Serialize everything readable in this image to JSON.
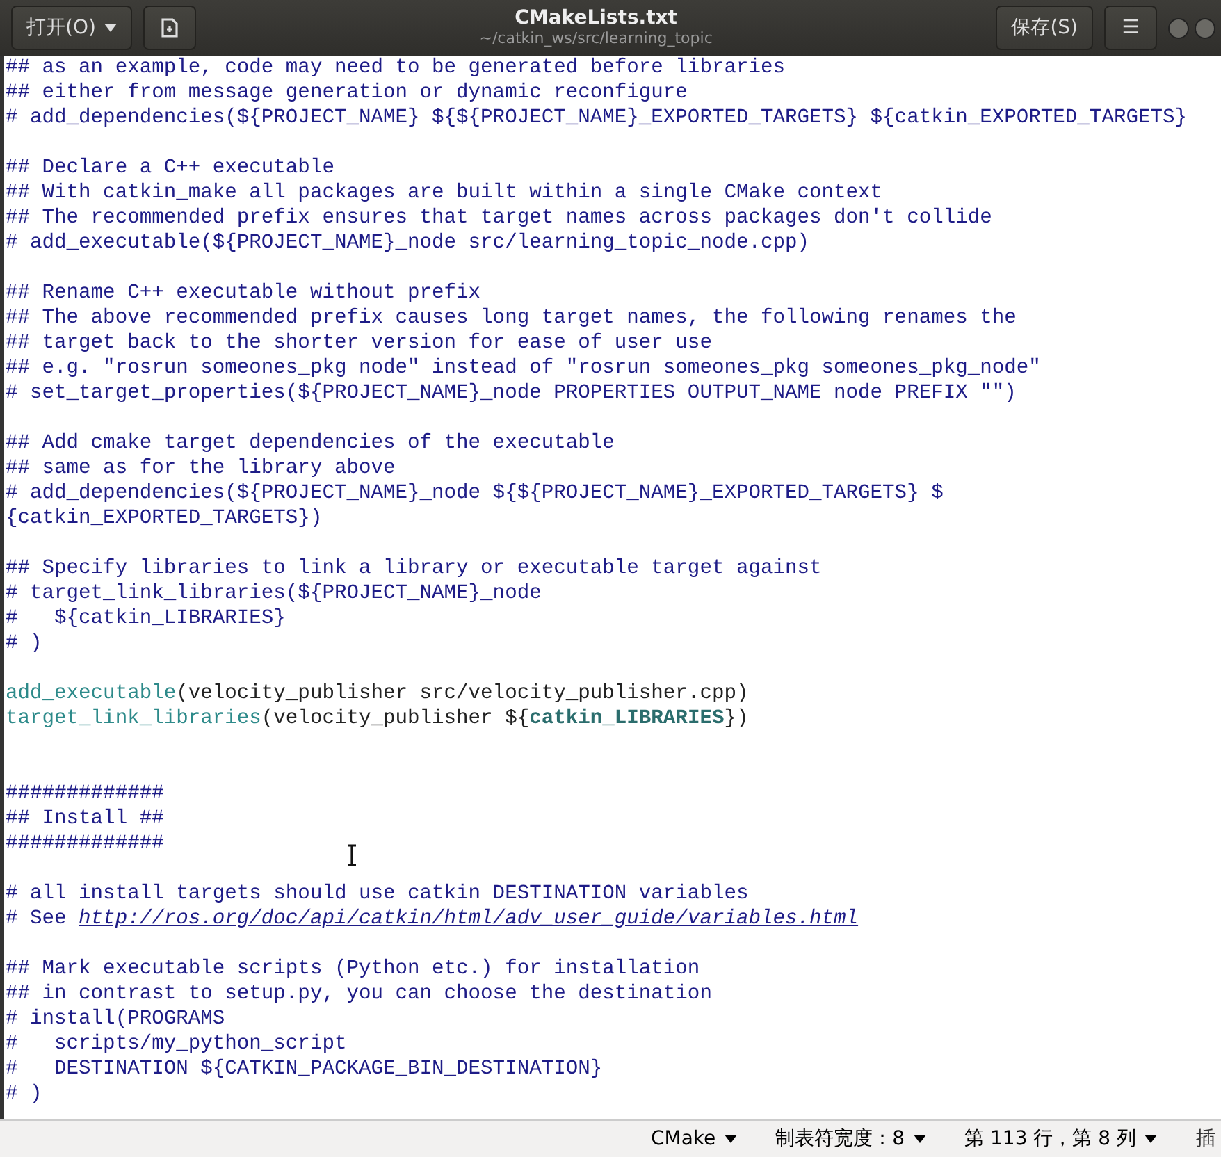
{
  "header": {
    "open_button": "打开(O)",
    "title": "CMakeLists.txt",
    "subtitle": "~/catkin_ws/src/learning_topic",
    "save_button": "保存(S)",
    "menu_button": "☰"
  },
  "lines": [
    {
      "kind": "text",
      "parts": [
        {
          "kind": "comment",
          "text": "## as an example, code may need to be generated before libraries"
        }
      ]
    },
    {
      "kind": "text",
      "parts": [
        {
          "kind": "comment",
          "text": "## either from message generation or dynamic reconfigure"
        }
      ]
    },
    {
      "kind": "text",
      "parts": [
        {
          "kind": "comment",
          "text": "# add_dependencies(${PROJECT_NAME} ${${PROJECT_NAME}_EXPORTED_TARGETS} ${catkin_EXPORTED_TARGETS}"
        }
      ]
    },
    {
      "kind": "blank"
    },
    {
      "kind": "text",
      "parts": [
        {
          "kind": "comment",
          "text": "## Declare a C++ executable"
        }
      ]
    },
    {
      "kind": "text",
      "parts": [
        {
          "kind": "comment",
          "text": "## With catkin_make all packages are built within a single CMake context"
        }
      ]
    },
    {
      "kind": "text",
      "parts": [
        {
          "kind": "comment",
          "text": "## The recommended prefix ensures that target names across packages don't collide"
        }
      ]
    },
    {
      "kind": "text",
      "parts": [
        {
          "kind": "comment",
          "text": "# add_executable(${PROJECT_NAME}_node src/learning_topic_node.cpp)"
        }
      ]
    },
    {
      "kind": "blank"
    },
    {
      "kind": "text",
      "parts": [
        {
          "kind": "comment",
          "text": "## Rename C++ executable without prefix"
        }
      ]
    },
    {
      "kind": "text",
      "parts": [
        {
          "kind": "comment",
          "text": "## The above recommended prefix causes long target names, the following renames the"
        }
      ]
    },
    {
      "kind": "text",
      "parts": [
        {
          "kind": "comment",
          "text": "## target back to the shorter version for ease of user use"
        }
      ]
    },
    {
      "kind": "text",
      "parts": [
        {
          "kind": "comment",
          "text": "## e.g. \"rosrun someones_pkg node\" instead of \"rosrun someones_pkg someones_pkg_node\""
        }
      ]
    },
    {
      "kind": "text",
      "parts": [
        {
          "kind": "comment",
          "text": "# set_target_properties(${PROJECT_NAME}_node PROPERTIES OUTPUT_NAME node PREFIX \"\")"
        }
      ]
    },
    {
      "kind": "blank"
    },
    {
      "kind": "text",
      "parts": [
        {
          "kind": "comment",
          "text": "## Add cmake target dependencies of the executable"
        }
      ]
    },
    {
      "kind": "text",
      "parts": [
        {
          "kind": "comment",
          "text": "## same as for the library above"
        }
      ]
    },
    {
      "kind": "text",
      "parts": [
        {
          "kind": "comment",
          "text": "# add_dependencies(${PROJECT_NAME}_node ${${PROJECT_NAME}_EXPORTED_TARGETS} $"
        }
      ]
    },
    {
      "kind": "text",
      "parts": [
        {
          "kind": "comment",
          "text": "{catkin_EXPORTED_TARGETS})"
        }
      ]
    },
    {
      "kind": "blank"
    },
    {
      "kind": "text",
      "parts": [
        {
          "kind": "comment",
          "text": "## Specify libraries to link a library or executable target against"
        }
      ]
    },
    {
      "kind": "text",
      "parts": [
        {
          "kind": "comment",
          "text": "# target_link_libraries(${PROJECT_NAME}_node"
        }
      ]
    },
    {
      "kind": "text",
      "parts": [
        {
          "kind": "comment",
          "text": "#   ${catkin_LIBRARIES}"
        }
      ]
    },
    {
      "kind": "text",
      "parts": [
        {
          "kind": "comment",
          "text": "# )"
        }
      ]
    },
    {
      "kind": "blank"
    },
    {
      "kind": "text",
      "parts": [
        {
          "kind": "function",
          "text": "add_executable"
        },
        {
          "kind": "plain",
          "text": "(velocity_publisher src/velocity_publisher.cpp)"
        }
      ]
    },
    {
      "kind": "text",
      "parts": [
        {
          "kind": "function",
          "text": "target_link_libraries"
        },
        {
          "kind": "plain",
          "text": "(velocity_publisher ${"
        },
        {
          "kind": "variable",
          "text": "catkin_LIBRARIES"
        },
        {
          "kind": "plain",
          "text": "})"
        }
      ]
    },
    {
      "kind": "blank"
    },
    {
      "kind": "blank"
    },
    {
      "kind": "text",
      "parts": [
        {
          "kind": "comment",
          "text": "#############"
        }
      ]
    },
    {
      "kind": "text",
      "parts": [
        {
          "kind": "comment",
          "text": "## Install ##"
        }
      ]
    },
    {
      "kind": "text",
      "parts": [
        {
          "kind": "comment",
          "text": "#############"
        }
      ]
    },
    {
      "kind": "blank"
    },
    {
      "kind": "text",
      "parts": [
        {
          "kind": "comment",
          "text": "# all install targets should use catkin DESTINATION variables"
        }
      ]
    },
    {
      "kind": "text",
      "parts": [
        {
          "kind": "comment",
          "text": "# See "
        },
        {
          "kind": "link",
          "text": "http://ros.org/doc/api/catkin/html/adv_user_guide/variables.html"
        }
      ]
    },
    {
      "kind": "blank"
    },
    {
      "kind": "text",
      "parts": [
        {
          "kind": "comment",
          "text": "## Mark executable scripts (Python etc.) for installation"
        }
      ]
    },
    {
      "kind": "text",
      "parts": [
        {
          "kind": "comment",
          "text": "## in contrast to setup.py, you can choose the destination"
        }
      ]
    },
    {
      "kind": "text",
      "parts": [
        {
          "kind": "comment",
          "text": "# install(PROGRAMS"
        }
      ]
    },
    {
      "kind": "text",
      "parts": [
        {
          "kind": "comment",
          "text": "#   scripts/my_python_script"
        }
      ]
    },
    {
      "kind": "text",
      "parts": [
        {
          "kind": "comment",
          "text": "#   DESTINATION ${CATKIN_PACKAGE_BIN_DESTINATION}"
        }
      ]
    },
    {
      "kind": "text",
      "parts": [
        {
          "kind": "comment",
          "text": "# )"
        }
      ]
    }
  ],
  "status_bar": {
    "language": "CMake",
    "tab_width": "制表符宽度：8",
    "position": "第 113 行，第 8 列",
    "mode": "插"
  }
}
